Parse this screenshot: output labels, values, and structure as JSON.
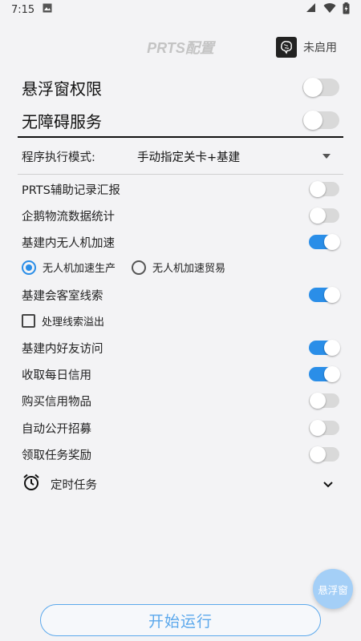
{
  "status_bar": {
    "time": "7:15"
  },
  "header": {
    "title": "PRTS配置",
    "user_status": "未启用"
  },
  "main_toggles": [
    {
      "label": "悬浮窗权限",
      "on": false
    },
    {
      "label": "无障碍服务",
      "on": false
    }
  ],
  "mode": {
    "label": "程序执行模式:",
    "value": "手动指定关卡+基建"
  },
  "settings": [
    {
      "label": "PRTS辅助记录汇报",
      "on": false
    },
    {
      "label": "企鹅物流数据统计",
      "on": false
    },
    {
      "label": "基建内无人机加速",
      "on": true
    },
    {
      "label": "基建会客室线索",
      "on": true
    },
    {
      "label": "基建内好友访问",
      "on": true
    },
    {
      "label": "收取每日信用",
      "on": true
    },
    {
      "label": "购买信用物品",
      "on": false
    },
    {
      "label": "自动公开招募",
      "on": false
    },
    {
      "label": "领取任务奖励",
      "on": false
    }
  ],
  "drone_options": {
    "option1": "无人机加速生产",
    "option2": "无人机加速贸易",
    "selected": "option1"
  },
  "overflow_checkbox": {
    "label": "处理线索溢出",
    "checked": false
  },
  "timer": {
    "label": "定时任务"
  },
  "fab_label": "悬浮窗",
  "start_label": "开始运行",
  "colors": {
    "accent": "#2a8ee8",
    "toggle_off": "#d9d9d9",
    "fab": "#a4cff7",
    "button_border": "#5ba8ec"
  }
}
